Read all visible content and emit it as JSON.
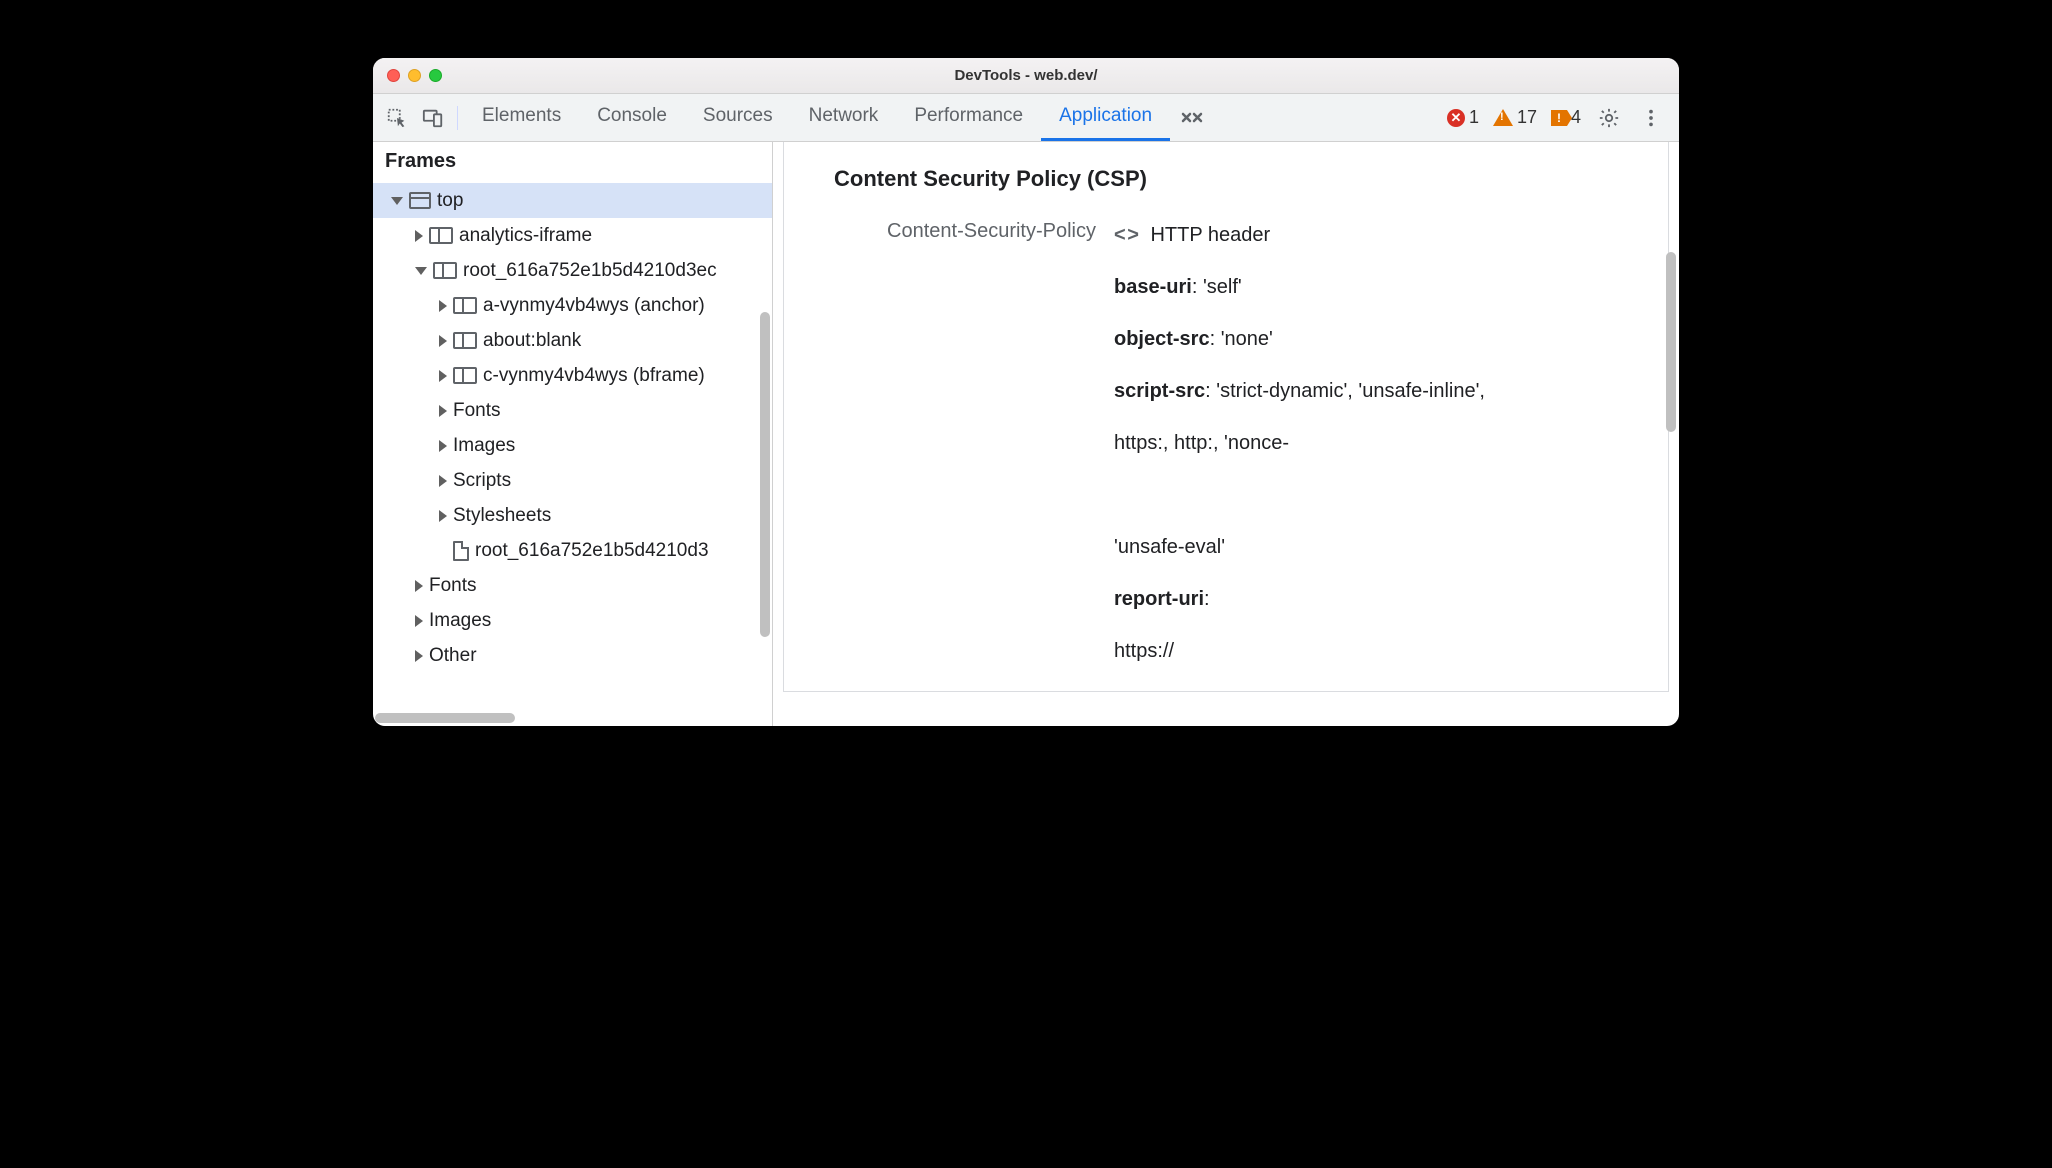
{
  "window": {
    "title": "DevTools - web.dev/"
  },
  "toolbar": {
    "tabs": [
      "Elements",
      "Console",
      "Sources",
      "Network",
      "Performance",
      "Application"
    ],
    "active_tab": "Application",
    "errors": "1",
    "warnings": "17",
    "issues": "4"
  },
  "sidebar": {
    "header": "Frames",
    "tree": {
      "top": "top",
      "children": [
        {
          "label": "analytics-iframe",
          "icon": "iframe",
          "expandable": true,
          "indent": 1
        },
        {
          "label": "root_616a752e1b5d4210d3ec",
          "icon": "iframe",
          "expandable": true,
          "expanded": true,
          "indent": 1
        },
        {
          "label": "a-vynmy4vb4wys (anchor)",
          "icon": "iframe",
          "expandable": true,
          "indent": 2
        },
        {
          "label": "about:blank",
          "icon": "iframe",
          "expandable": true,
          "indent": 2
        },
        {
          "label": "c-vynmy4vb4wys (bframe)",
          "icon": "iframe",
          "expandable": true,
          "indent": 2
        },
        {
          "label": "Fonts",
          "icon": "none",
          "expandable": true,
          "indent": 2
        },
        {
          "label": "Images",
          "icon": "none",
          "expandable": true,
          "indent": 2
        },
        {
          "label": "Scripts",
          "icon": "none",
          "expandable": true,
          "indent": 2
        },
        {
          "label": "Stylesheets",
          "icon": "none",
          "expandable": true,
          "indent": 2
        },
        {
          "label": "root_616a752e1b5d4210d3",
          "icon": "doc",
          "expandable": false,
          "indent": 2
        },
        {
          "label": "Fonts",
          "icon": "none",
          "expandable": true,
          "indent": 1
        },
        {
          "label": "Images",
          "icon": "none",
          "expandable": true,
          "indent": 1
        },
        {
          "label": "Other",
          "icon": "none",
          "expandable": true,
          "indent": 1
        }
      ]
    }
  },
  "main": {
    "panel_title": "Content Security Policy (CSP)",
    "policy_label": "Content-Security-Policy",
    "delivery": "HTTP header",
    "directives": [
      {
        "name": "base-uri",
        "value": "'self'"
      },
      {
        "name": "object-src",
        "value": "'none'"
      },
      {
        "name": "script-src",
        "value": "'strict-dynamic', 'unsafe-inline',"
      },
      {
        "name": "",
        "value": "https:, http:, 'nonce-"
      },
      {
        "name": "",
        "value": " "
      },
      {
        "name": "",
        "value": "'unsafe-eval'"
      },
      {
        "name": "report-uri",
        "value": ""
      },
      {
        "name": "",
        "value": "https://"
      }
    ]
  }
}
